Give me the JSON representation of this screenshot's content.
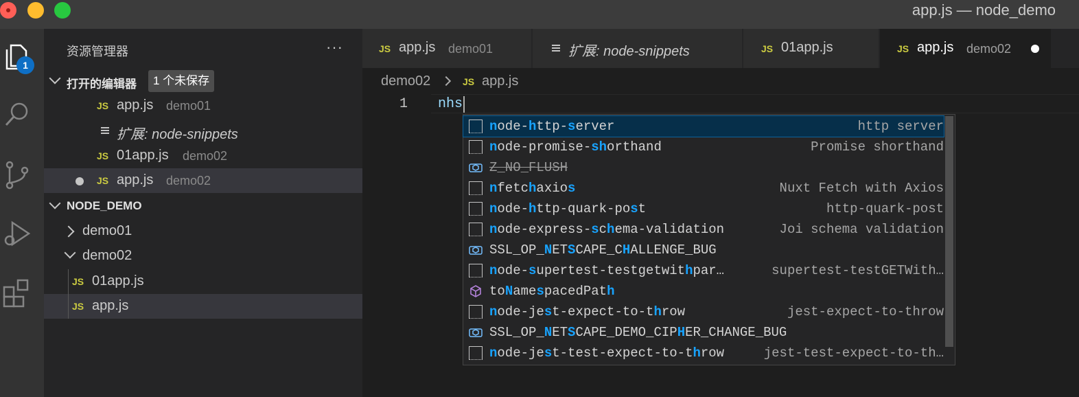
{
  "window": {
    "title": "app.js — node_demo"
  },
  "activity_bar": {
    "badge_count": "1"
  },
  "sidebar": {
    "title": "资源管理器",
    "more": "···",
    "open_editors": {
      "title": "打开的编辑器",
      "unsaved_badge": "1 个未保存",
      "items": [
        {
          "icon": "JS",
          "name": "app.js",
          "desc": "demo01"
        },
        {
          "icon": "≡",
          "name": "扩展: node-snippets",
          "desc": ""
        },
        {
          "icon": "JS",
          "name": "01app.js",
          "desc": "demo02"
        },
        {
          "icon": "JS",
          "name": "app.js",
          "desc": "demo02"
        }
      ]
    },
    "project": {
      "title": "NODE_DEMO",
      "folders": [
        {
          "name": "demo01"
        },
        {
          "name": "demo02"
        }
      ],
      "files": [
        {
          "icon": "JS",
          "name": "01app.js"
        },
        {
          "icon": "JS",
          "name": "app.js"
        }
      ]
    }
  },
  "tabs": [
    {
      "icon": "JS",
      "name": "app.js",
      "desc": "demo01"
    },
    {
      "icon": "≡",
      "name": "扩展: node-snippets",
      "desc": ""
    },
    {
      "icon": "JS",
      "name": "01app.js",
      "desc": ""
    },
    {
      "icon": "JS",
      "name": "app.js",
      "desc": "demo02"
    }
  ],
  "breadcrumb": {
    "folder": "demo02",
    "icon": "JS",
    "file": "app.js"
  },
  "editor": {
    "line_number": "1",
    "text": "nhs"
  },
  "suggestions": [
    {
      "icon": "snippet-icon",
      "parts": [
        [
          "n",
          1
        ],
        [
          "ode-",
          0
        ],
        [
          "h",
          1
        ],
        [
          "ttp-",
          0
        ],
        [
          "s",
          1
        ],
        [
          "erver",
          0
        ]
      ],
      "detail": "http server"
    },
    {
      "icon": "snippet-icon",
      "parts": [
        [
          "n",
          1
        ],
        [
          "ode-promise-",
          0
        ],
        [
          "sh",
          1
        ],
        [
          "orthand",
          0
        ]
      ],
      "detail": "Promise shorthand"
    },
    {
      "icon": "constant-icon",
      "parts": [
        [
          "Z_NO_FLUSH",
          0
        ]
      ],
      "detail": "",
      "deprecated": true
    },
    {
      "icon": "snippet-icon",
      "parts": [
        [
          "n",
          1
        ],
        [
          "fetc",
          0
        ],
        [
          "h",
          1
        ],
        [
          "axio",
          0
        ],
        [
          "s",
          1
        ]
      ],
      "detail": "Nuxt Fetch with Axios"
    },
    {
      "icon": "snippet-icon",
      "parts": [
        [
          "n",
          1
        ],
        [
          "ode-",
          0
        ],
        [
          "h",
          1
        ],
        [
          "ttp-quark-po",
          0
        ],
        [
          "s",
          1
        ],
        [
          "t",
          0
        ]
      ],
      "detail": "http-quark-post"
    },
    {
      "icon": "snippet-icon",
      "parts": [
        [
          "n",
          1
        ],
        [
          "ode-express-",
          0
        ],
        [
          "s",
          1
        ],
        [
          "c",
          0
        ],
        [
          "h",
          1
        ],
        [
          "ema-validation",
          0
        ]
      ],
      "detail": "Joi schema validation"
    },
    {
      "icon": "constant-icon",
      "parts": [
        [
          "SSL_OP_",
          0
        ],
        [
          "N",
          1
        ],
        [
          "ET",
          0
        ],
        [
          "S",
          1
        ],
        [
          "CAPE_C",
          0
        ],
        [
          "H",
          1
        ],
        [
          "ALLENGE_BUG",
          0
        ]
      ],
      "detail": ""
    },
    {
      "icon": "snippet-icon",
      "parts": [
        [
          "n",
          1
        ],
        [
          "ode-",
          0
        ],
        [
          "s",
          1
        ],
        [
          "upertest-testgetwit",
          0
        ],
        [
          "h",
          1
        ],
        [
          "par…",
          0
        ]
      ],
      "detail": "supertest-testGETWith…"
    },
    {
      "icon": "method-icon",
      "parts": [
        [
          "to",
          0
        ],
        [
          "N",
          1
        ],
        [
          "ame",
          0
        ],
        [
          "s",
          1
        ],
        [
          "pacedPat",
          0
        ],
        [
          "h",
          1
        ]
      ],
      "detail": ""
    },
    {
      "icon": "snippet-icon",
      "parts": [
        [
          "n",
          1
        ],
        [
          "ode-je",
          0
        ],
        [
          "s",
          1
        ],
        [
          "t-expect-to-t",
          0
        ],
        [
          "h",
          1
        ],
        [
          "row",
          0
        ]
      ],
      "detail": "jest-expect-to-throw"
    },
    {
      "icon": "constant-icon",
      "parts": [
        [
          "SSL_OP_",
          0
        ],
        [
          "N",
          1
        ],
        [
          "ET",
          0
        ],
        [
          "S",
          1
        ],
        [
          "CAPE_DEMO_CIP",
          0
        ],
        [
          "H",
          1
        ],
        [
          "ER_CHANGE_BUG",
          0
        ]
      ],
      "detail": ""
    },
    {
      "icon": "snippet-icon",
      "parts": [
        [
          "n",
          1
        ],
        [
          "ode-je",
          0
        ],
        [
          "s",
          1
        ],
        [
          "t-test-expect-to-t",
          0
        ],
        [
          "h",
          1
        ],
        [
          "row",
          0
        ]
      ],
      "detail": "jest-test-expect-to-th…"
    }
  ],
  "colors": {
    "accent": "#0e6fc5",
    "highlight": "#18a3ff",
    "js_icon": "#cbcb41"
  }
}
